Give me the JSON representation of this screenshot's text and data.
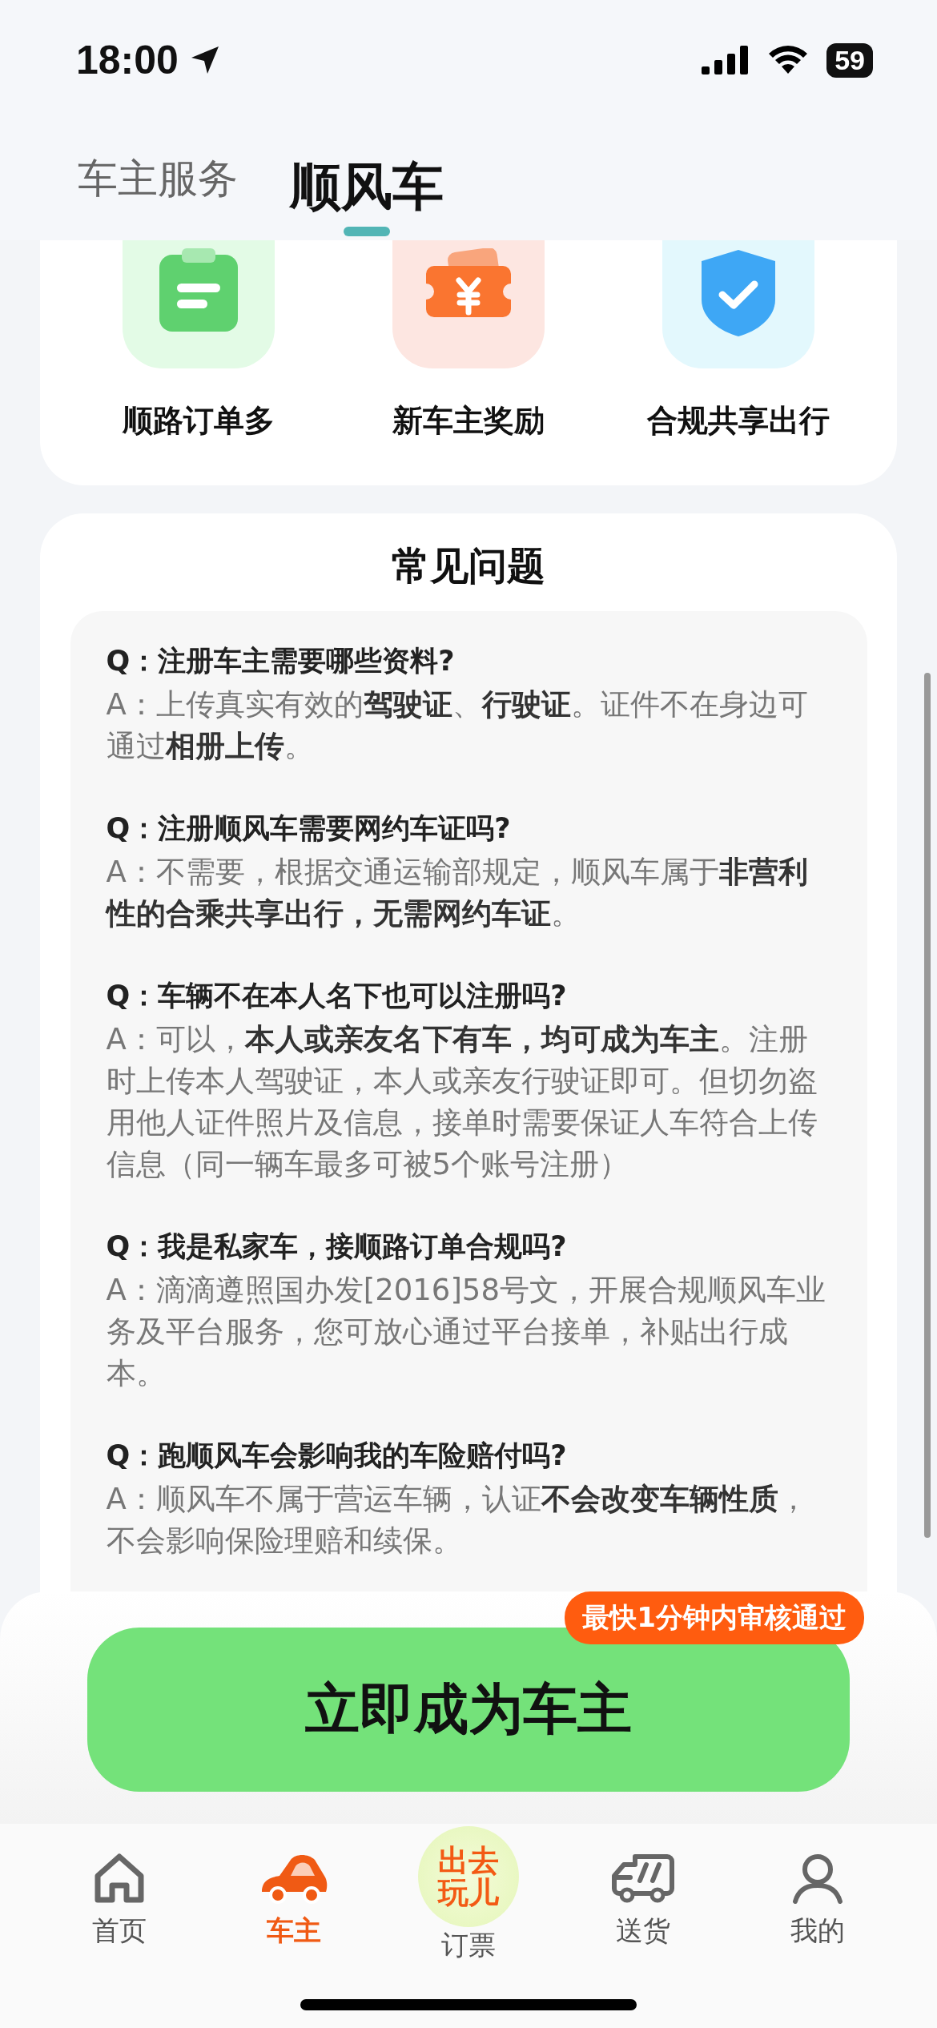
{
  "status_bar": {
    "time": "18:00",
    "battery": "59"
  },
  "tabs": [
    {
      "label": "车主服务",
      "selected": false
    },
    {
      "label": "顺风车",
      "selected": true
    }
  ],
  "features": [
    {
      "kind": "clipboard",
      "label": "顺路订单多"
    },
    {
      "kind": "ticket",
      "label": "新车主奖励"
    },
    {
      "kind": "shield",
      "label": "合规共享出行"
    }
  ],
  "faq": {
    "title": "常见问题",
    "items": [
      {
        "question": "Q：注册车主需要哪些资料?",
        "answer": "A：上传真实有效的**驾驶证**、**行驶证**。证件不在身边可通过**相册上传**。"
      },
      {
        "question": "Q：注册顺风车需要网约车证吗?",
        "answer": "A：不需要，根据交通运输部规定，顺风车属于**非营利性的合乘共享出行，无需网约车证**。"
      },
      {
        "question": "Q：车辆不在本人名下也可以注册吗?",
        "answer": "A：可以，**本人或亲友名下有车，均可成为车主**。注册时上传本人驾驶证，本人或亲友行驶证即可。但切勿盗用他人证件照片及信息，接单时需要保证人车符合上传信息（同一辆车最多可被5个账号注册）"
      },
      {
        "question": "Q：我是私家车，接顺路订单合规吗?",
        "answer": "A：滴滴遵照国办发[2016]58号文，开展合规顺风车业务及平台服务，您可放心通过平台接单，补贴出行成本。"
      },
      {
        "question": "Q：跑顺风车会影响我的车险赔付吗?",
        "answer": "A：顺风车不属于营运车辆，认证**不会改变车辆性质**，不会影响保险理赔和续保。"
      }
    ]
  },
  "cta": {
    "label": "立即成为车主",
    "badge": "最快1分钟内审核通过"
  },
  "nav": [
    {
      "kind": "home",
      "label": "首页",
      "selected": false
    },
    {
      "kind": "car",
      "label": "车主",
      "selected": true
    },
    {
      "kind": "promo",
      "label": "订票",
      "promo_lines": [
        "出去",
        "玩儿"
      ],
      "selected": false
    },
    {
      "kind": "truck",
      "label": "送货",
      "selected": false
    },
    {
      "kind": "person",
      "label": "我的",
      "selected": false
    }
  ]
}
